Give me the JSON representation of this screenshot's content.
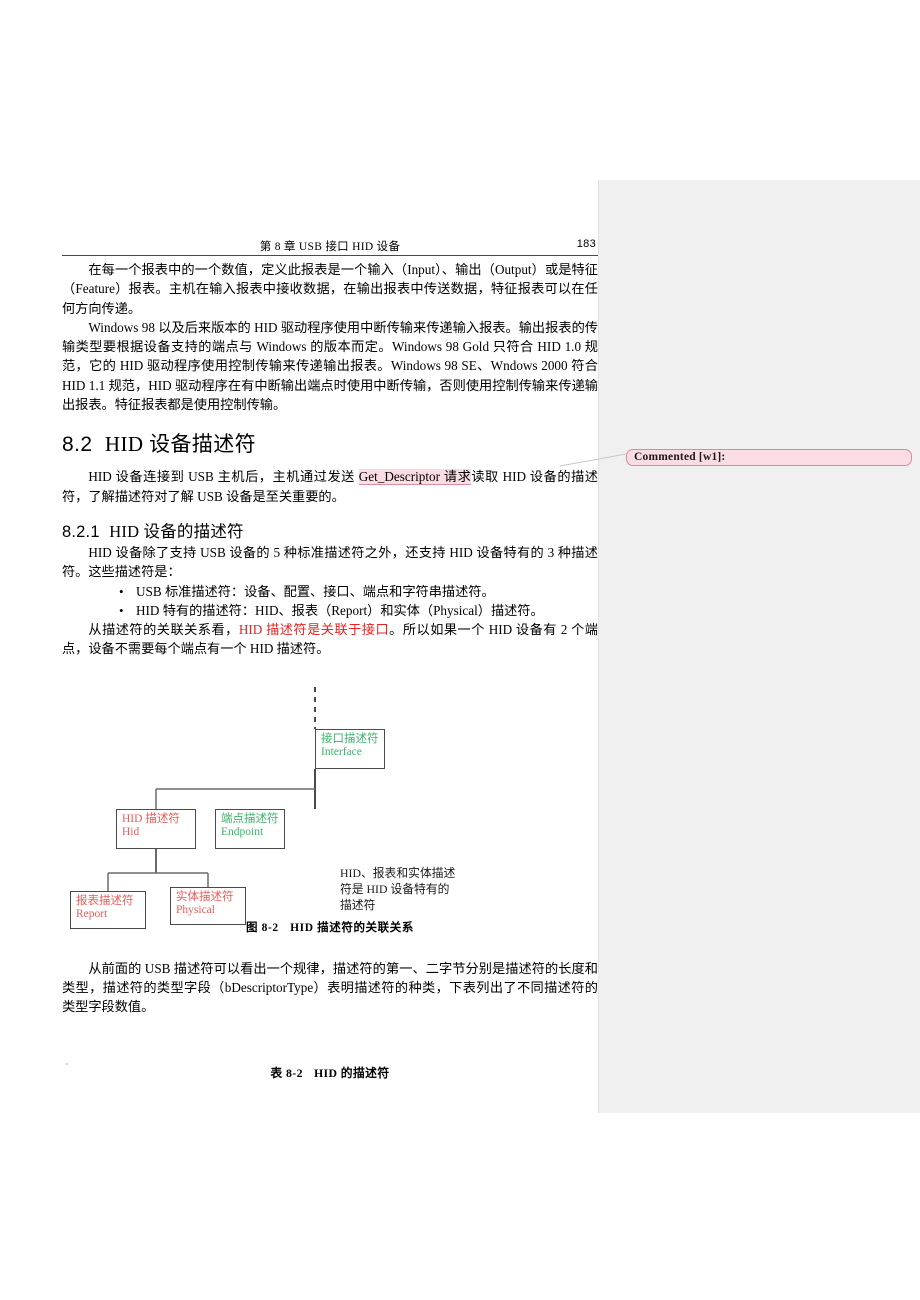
{
  "page": {
    "running_head": "第 8 章  USB 接口 HID 设备",
    "page_number": "183"
  },
  "paragraphs": {
    "p1": "在每一个报表中的一个数值，定义此报表是一个输入（Input）、输出（Output）或是特征（Feature）报表。主机在输入报表中接收数据，在输出报表中传送数据，特征报表可以在任何方向传递。",
    "p2": "Windows 98 以及后来版本的 HID 驱动程序使用中断传输来传递输入报表。输出报表的传输类型要根据设备支持的端点与 Windows 的版本而定。Windows 98 Gold 只符合 HID 1.0 规范，它的 HID 驱动程序使用控制传输来传递输出报表。Windows 98 SE、Wndows 2000 符合 HID 1.1 规范，HID 驱动程序在有中断输出端点时使用中断传输，否则使用控制传输来传递输出报表。特征报表都是使用控制传输。",
    "p3_before": "HID 设备连接到 USB 主机后，主机通过发送 ",
    "p3_highlight": "Get_Descriptor 请求",
    "p3_after": "读取 HID 设备的描述符，了解描述符对了解 USB 设备是至关重要的。",
    "p4": "HID 设备除了支持 USB 设备的 5 种标准描述符之外，还支持 HID 设备特有的 3 种描述符。这些描述符是：",
    "p5_before": "从描述符的关联关系看，",
    "p5_red": "HID 描述符是关联于接口",
    "p5_after": "。所以如果一个 HID 设备有 2 个端点，设备不需要每个端点有一个 HID 描述符。",
    "p6": "从前面的 USB 描述符可以看出一个规律，描述符的第一、二字节分别是描述符的长度和类型，描述符的类型字段（bDescriptorType）表明描述符的种类，下表列出了不同描述符的类型字段数值。"
  },
  "headings": {
    "section": "8.2  HID 设备描述符",
    "section_num": "8.2",
    "section_title": "HID 设备描述符",
    "subsection_num": "8.2.1",
    "subsection_title": "HID 设备的描述符"
  },
  "bullets": [
    {
      "marker": "•",
      "text": "USB 标准描述符：设备、配置、接口、端点和字符串描述符。"
    },
    {
      "marker": "•",
      "text": "HID 特有的描述符：HID、报表（Report）和实体（Physical）描述符。"
    }
  ],
  "comment": {
    "label": "Commented [w1]:",
    "body": "",
    "accent": "#fadde3",
    "border": "#d48c9e"
  },
  "figure": {
    "caption_num": "图 8-2",
    "caption_text": "HID 描述符的关联关系",
    "note": "HID、报表和实体描述符是 HID 设备特有的描述符",
    "colors": {
      "green": "#39b36a",
      "red": "#ef5a58",
      "line": "#4a4a4a"
    },
    "nodes": [
      {
        "id": "interface",
        "cn": "接口描述符",
        "en": "Interface",
        "color": "green"
      },
      {
        "id": "hid",
        "cn": "HID 描述符",
        "en": "Hid",
        "color": "red"
      },
      {
        "id": "endpoint",
        "cn": "端点描述符",
        "en": "Endpoint",
        "color": "green"
      },
      {
        "id": "report",
        "cn": "报表描述符",
        "en": "Report",
        "color": "red"
      },
      {
        "id": "physical",
        "cn": "实体描述符",
        "en": "Physical",
        "color": "red"
      }
    ]
  },
  "table_caption": {
    "num": "表 8-2",
    "text": "HID 的描述符"
  }
}
